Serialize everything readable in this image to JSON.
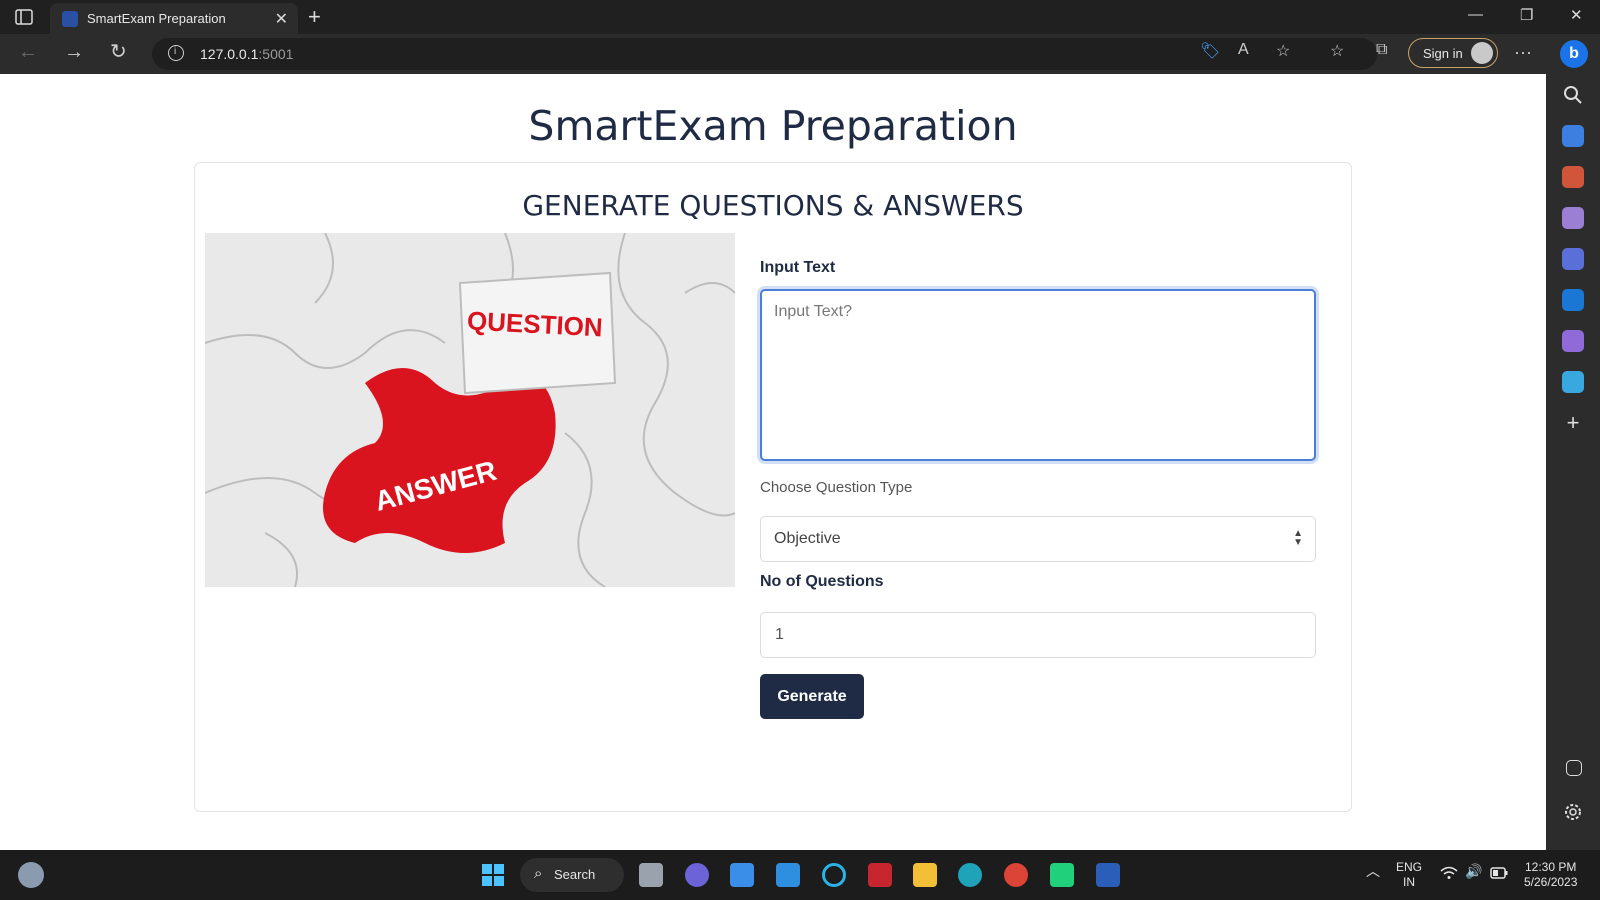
{
  "browser": {
    "tab_title": "SmartExam Preparation",
    "tab_close": "✕",
    "new_tab": "+",
    "url_host": "127.0.0.1",
    "url_port": ":5001",
    "sign_in": "Sign in",
    "more": "···",
    "bing": "b",
    "window_controls": {
      "minimize": "—",
      "restore": "❐",
      "close": "✕"
    },
    "nav": {
      "back": "←",
      "forward": "→",
      "refresh": "↻"
    },
    "addr_icons": {
      "tag": "🏷",
      "read_aloud": "A",
      "favorite_add": "☆",
      "favorites": "☆",
      "collections": "⧉"
    }
  },
  "page": {
    "title": "SmartExam Preparation",
    "card_title": "GENERATE QUESTIONS & ANSWERS",
    "image": {
      "word_question": "QUESTION",
      "word_answer": "ANSWER"
    },
    "form": {
      "input_label": "Input Text",
      "input_placeholder": "Input Text?",
      "type_label": "Choose Question Type",
      "type_value": "Objective",
      "count_label": "No of Questions",
      "count_value": "1",
      "generate_label": "Generate"
    }
  },
  "sidebar_icons": [
    "search-icon",
    "tag-icon",
    "toolbox-icon",
    "games-icon",
    "copilot-icon",
    "outlook-icon",
    "designer-icon",
    "send-icon",
    "add-icon",
    "split-screen-icon",
    "settings-icon"
  ],
  "taskbar": {
    "search_label": "Search",
    "lang_top": "ENG",
    "lang_bottom": "IN",
    "time": "12:30 PM",
    "date": "5/26/2023"
  },
  "colors": {
    "accent": "#1f2a44",
    "focus_border": "#4b7fd6",
    "image_red": "#d9141e"
  }
}
